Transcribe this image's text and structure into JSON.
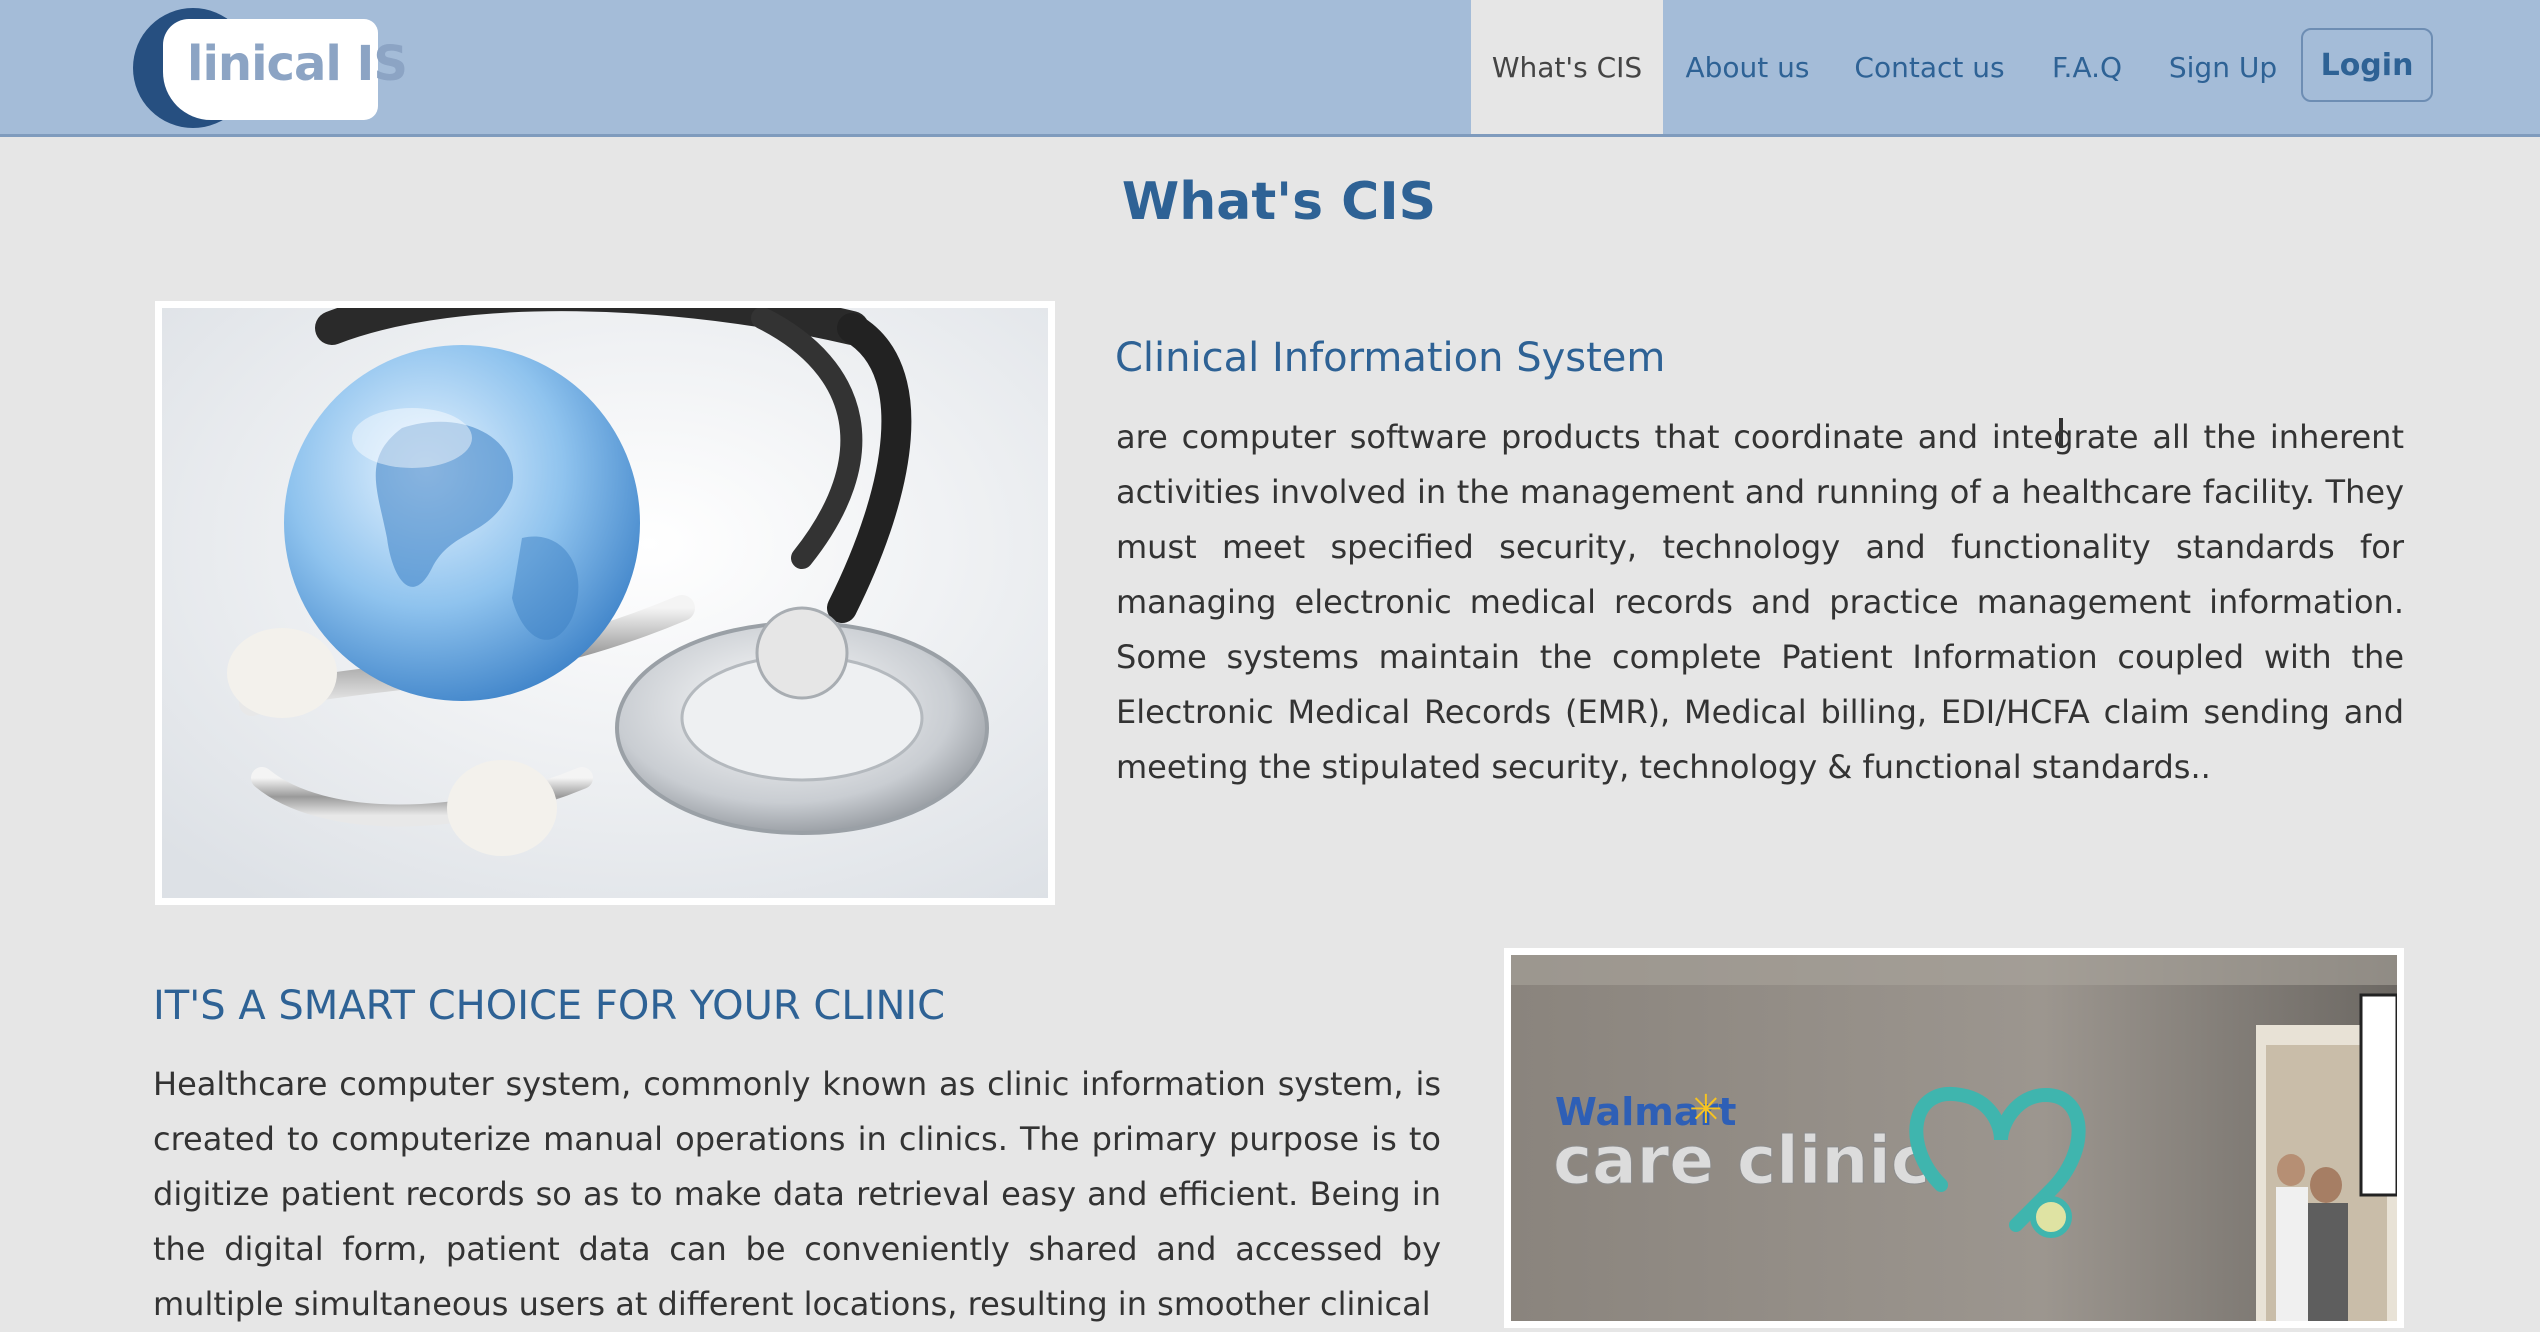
{
  "header": {
    "logo_text": "linical IS",
    "nav": [
      {
        "label": "What's CIS"
      },
      {
        "label": "About us"
      },
      {
        "label": "Contact us"
      },
      {
        "label": "F.A.Q"
      },
      {
        "label": "Sign Up"
      }
    ],
    "login_label": "Login"
  },
  "page": {
    "title": "What's CIS"
  },
  "sections": [
    {
      "title": "Clinical Information System",
      "text": "are computer software products that coordinate and integrate all the inherent activities involved in the management and running of a healthcare facility. They must meet specified security, technology and functionality standards for managing electronic medical records and practice management information. Some systems maintain the complete Patient Information coupled with the Electronic Medical Records (EMR), Medical billing, EDI/HCFA claim sending and meeting the stipulated security, technology & functional standards.."
    },
    {
      "title": "IT'S A SMART CHOICE FOR YOUR CLINIC",
      "text": "Healthcare computer system, commonly known as clinic information system, is created to computerize manual operations in clinics. The primary purpose is to digitize patient records so as to make data retrieval easy and efficient. Being in the digital form, patient data can be conveniently shared and accessed by multiple simultaneous users at different locations, resulting in smoother clinical"
    }
  ],
  "photos": {
    "clinic_sign_brand": "Walmart",
    "clinic_sign_name": "care clinic"
  },
  "colors": {
    "navbar_bg": "#a4bcd8",
    "page_bg": "#e6e6e6",
    "accent": "#2e6295",
    "body_text": "#333333"
  }
}
